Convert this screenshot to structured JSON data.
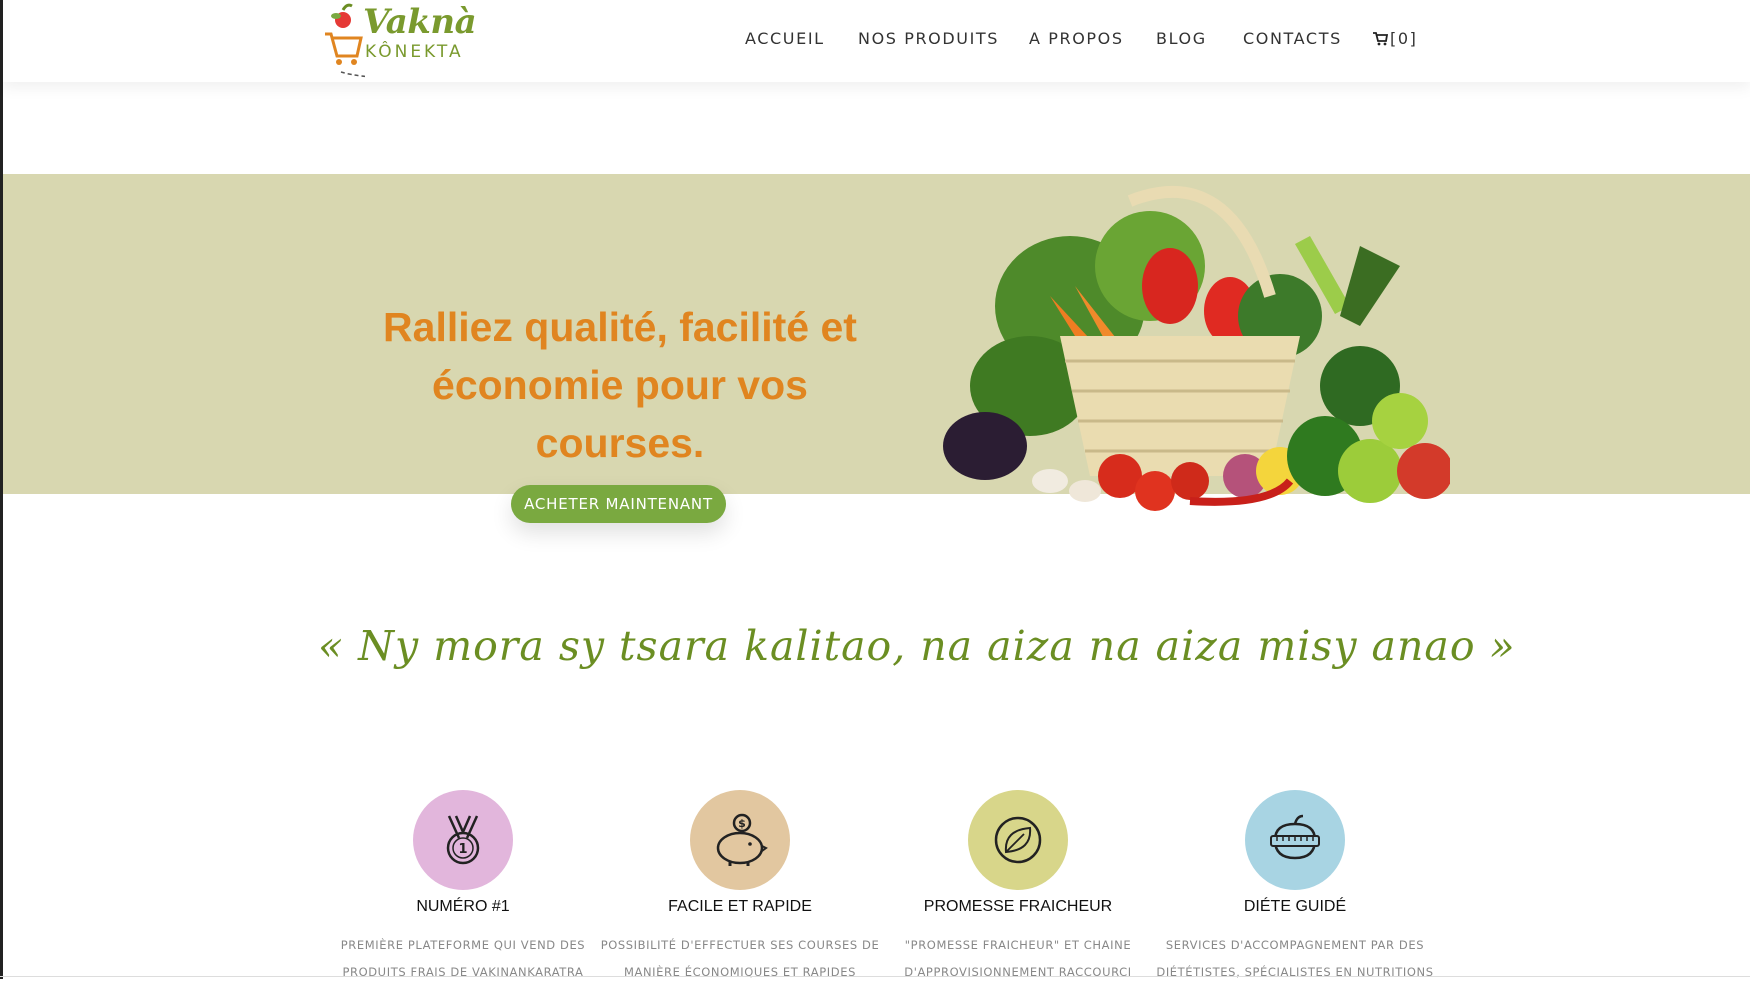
{
  "logo": {
    "word1": "Vaknà",
    "word2": "KÔNEKTA"
  },
  "nav": {
    "items": [
      {
        "label": "ACCUEIL"
      },
      {
        "label": "NOS PRODUITS"
      },
      {
        "label": "A PROPOS"
      },
      {
        "label": "BLOG"
      },
      {
        "label": "CONTACTS"
      }
    ],
    "cart_count": "[0]",
    "cart_icon": "cart-icon"
  },
  "hero": {
    "title": "Ralliez qualité, facilité et économie pour vos courses.",
    "button_label": "ACHETER MAINTENANT",
    "background_color": "#d8d7b0",
    "title_color": "#e08520",
    "button_color": "#7aa940"
  },
  "slogan": "« Ny mora sy tsara kalitao, na aiza na aiza misy anao »",
  "features": [
    {
      "icon": "medal-icon",
      "color": "#e2b6dc",
      "title": "NUMÉRO #1",
      "desc_line1": "PREMIÈRE PLATEFORME QUI VEND DES",
      "desc_line2": "PRODUITS FRAIS DE VAKINANKARATRA"
    },
    {
      "icon": "piggy-bank-icon",
      "color": "#e2c7a0",
      "title": "FACILE ET RAPIDE",
      "desc_line1": "POSSIBILITÉ D'EFFECTUER SES COURSES DE",
      "desc_line2": "MANIÈRE ÉCONOMIQUES ET RAPIDES"
    },
    {
      "icon": "leaf-icon",
      "color": "#d8d68a",
      "title": "PROMESSE FRAICHEUR",
      "desc_line1": "\"PROMESSE FRAICHEUR\" ET CHAINE",
      "desc_line2": "D'APPROVISIONNEMENT RACCOURCI"
    },
    {
      "icon": "diet-icon",
      "color": "#a8d4e3",
      "title": "DIÉTE GUIDÉ",
      "desc_line1": "SERVICES D'ACCOMPAGNEMENT PAR DES",
      "desc_line2": "DIÉTÉTISTES, SPÉCIALISTES EN NUTRITIONS"
    }
  ]
}
